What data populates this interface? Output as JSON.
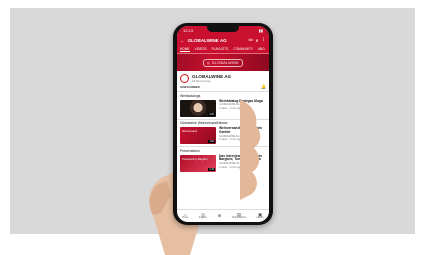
{
  "status": {
    "time": "12:13"
  },
  "appbar": {
    "title": "GLOBALWINE AG"
  },
  "tabs": [
    "HOME",
    "VIDEOS",
    "PLAYLISTS",
    "COMMUNITY",
    "ABO"
  ],
  "channel": {
    "name": "GLOBALWINE AG",
    "subs": "24 Abonnenten",
    "subscribe": "SUBSCRIBED"
  },
  "sections": [
    {
      "title": "Weinkatalogs",
      "video": {
        "title": "Weinkatalog Bodegas Muga",
        "channel": "GLOBALWINE AG",
        "meta": "4 views · 1 hour ago",
        "duration": "3:20"
      }
    },
    {
      "title": "Globalwine Weinversandhäuser",
      "video": {
        "title": "Weinversandhaus mit Alain Genitet",
        "channel": "GLOBALWINE AG",
        "meta": "4 views · 1 hour ago",
        "duration": "1:02",
        "thumb_text": "Weinversand"
      }
    },
    {
      "title": "Presenations",
      "video": {
        "title": "Das Interview mit Leonardo Bargioni, Tomás Argentina",
        "channel": "GLOBALWINE AG",
        "meta": "4 views · 1 hour ago",
        "duration": "2:10",
        "thumb_text": "Presented by Bargioni"
      }
    }
  ],
  "nav": [
    "Home",
    "Explore",
    "",
    "Subscriptions",
    "Library"
  ]
}
